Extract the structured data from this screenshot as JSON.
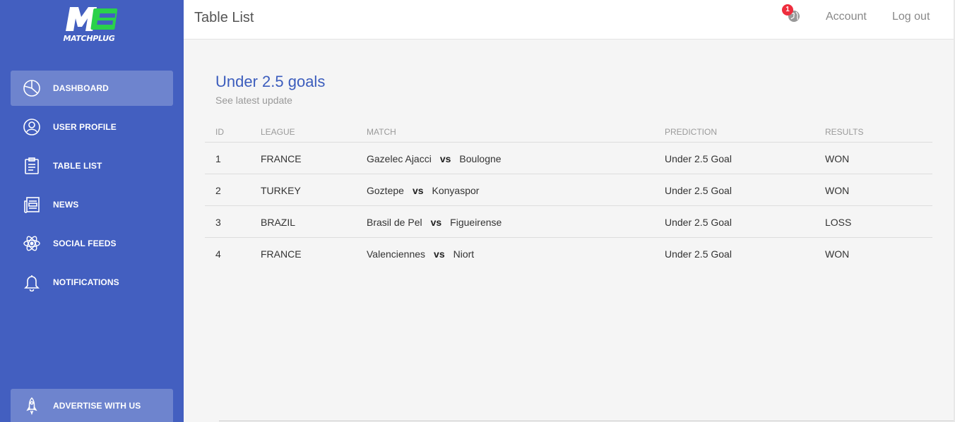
{
  "brand": {
    "logo_text": "MATCHPLUG"
  },
  "sidebar": {
    "items": [
      {
        "label": "DASHBOARD",
        "icon": "pie-chart-icon",
        "active": true
      },
      {
        "label": "USER PROFILE",
        "icon": "user-icon",
        "active": false
      },
      {
        "label": "TABLE LIST",
        "icon": "clipboard-icon",
        "active": false
      },
      {
        "label": "NEWS",
        "icon": "newspaper-icon",
        "active": false
      },
      {
        "label": "SOCIAL FEEDS",
        "icon": "atom-icon",
        "active": false
      },
      {
        "label": "NOTIFICATIONS",
        "icon": "bell-icon",
        "active": false
      }
    ],
    "advertise_label": "ADVERTISE WITH US",
    "advertise_icon": "rocket-icon"
  },
  "header": {
    "title": "Table List",
    "notification_count": "1",
    "account_label": "Account",
    "logout_label": "Log out"
  },
  "card": {
    "title": "Under 2.5 goals",
    "subtitle": "See latest update",
    "columns": [
      "ID",
      "LEAGUE",
      "MATCH",
      "PREDICTION",
      "RESULTS"
    ],
    "vs_label": "vs",
    "rows": [
      {
        "id": "1",
        "league": "FRANCE",
        "home": "Gazelec Ajacci",
        "away": "Boulogne",
        "prediction": "Under 2.5 Goal",
        "result": "WON"
      },
      {
        "id": "2",
        "league": "TURKEY",
        "home": "Goztepe",
        "away": "Konyaspor",
        "prediction": "Under 2.5 Goal",
        "result": "WON"
      },
      {
        "id": "3",
        "league": "BRAZIL",
        "home": "Brasil de Pel",
        "away": "Figueirense",
        "prediction": "Under 2.5 Goal",
        "result": "LOSS"
      },
      {
        "id": "4",
        "league": "FRANCE",
        "home": "Valenciennes",
        "away": "Niort",
        "prediction": "Under 2.5 Goal",
        "result": "WON"
      }
    ]
  },
  "colors": {
    "sidebar": "#435fc0",
    "accent": "#3c5dbd",
    "logo_green": "#2ad14a",
    "badge": "#ee2d3d"
  }
}
